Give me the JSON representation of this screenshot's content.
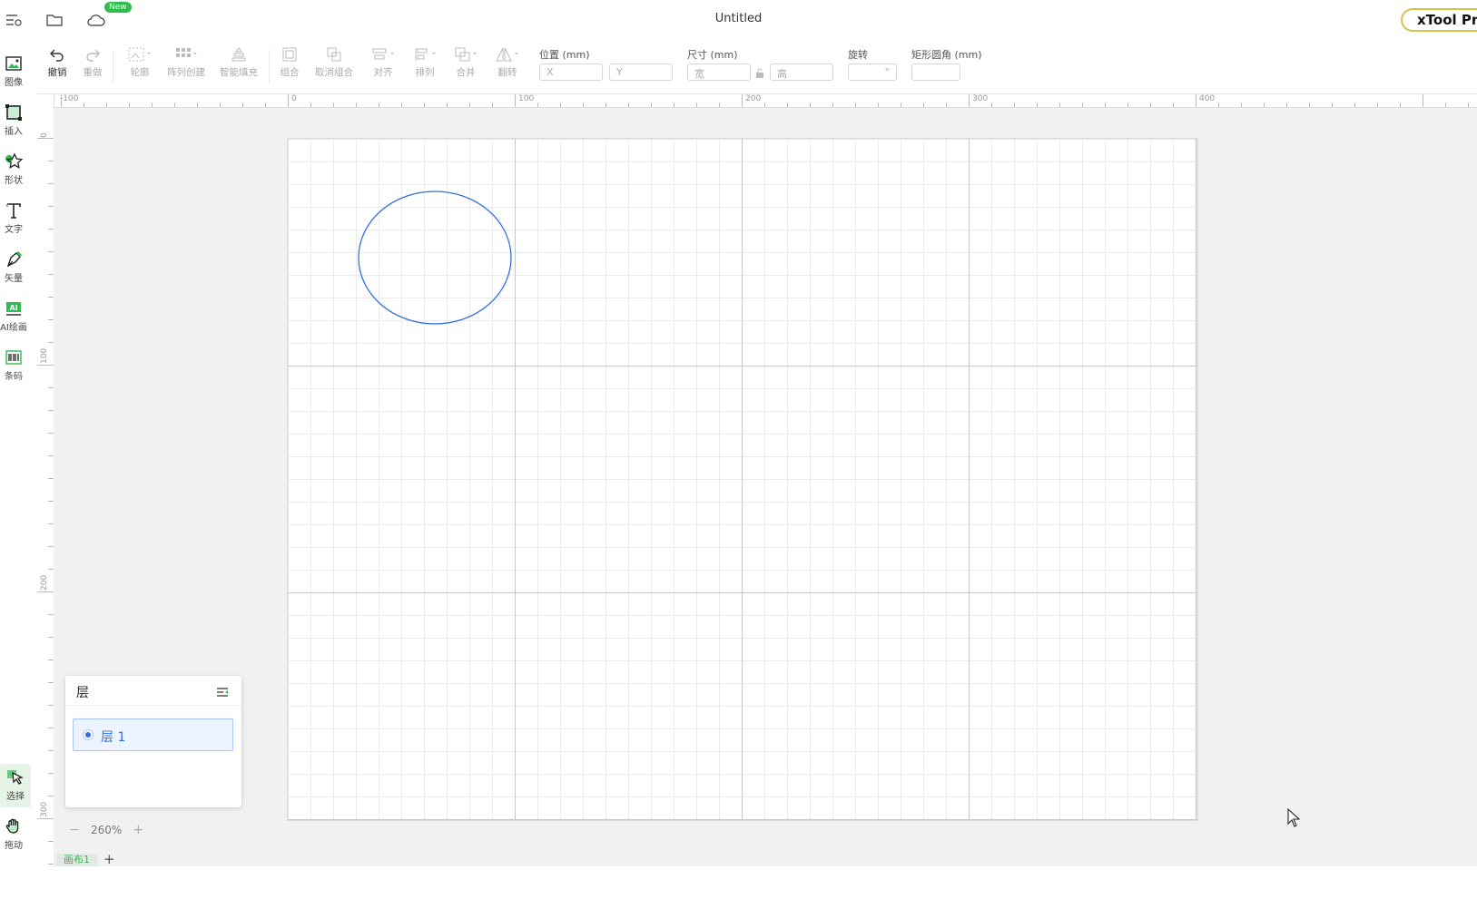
{
  "titlebar": {
    "new_badge": "New",
    "doc_title": "Untitled",
    "product_button": "xTool Pro"
  },
  "sidebar": {
    "items": [
      {
        "label": "图像",
        "icon": "image-icon"
      },
      {
        "label": "插入",
        "icon": "insert-icon"
      },
      {
        "label": "形状",
        "icon": "shape-star-icon"
      },
      {
        "label": "文字",
        "icon": "text-icon"
      },
      {
        "label": "矢量",
        "icon": "pen-icon"
      },
      {
        "label": "AI绘画",
        "icon": "ai-paint-icon"
      },
      {
        "label": "条码",
        "icon": "barcode-icon"
      }
    ],
    "bottom_items": [
      {
        "label": "选择",
        "icon": "select-cursor-icon"
      },
      {
        "label": "拖动",
        "icon": "hand-icon"
      }
    ],
    "accent": "#2ebd4e"
  },
  "toolbar": {
    "undo": "撤销",
    "redo": "重做",
    "outline": "轮廓",
    "array": "阵列创建",
    "smart_fill": "智能填充",
    "group": "组合",
    "ungroup": "取消组合",
    "align": "对齐",
    "arrange": "排列",
    "combine": "合并",
    "flip": "翻转",
    "position_label": "位置 (mm)",
    "x_placeholder": "X",
    "y_placeholder": "Y",
    "size_label": "尺寸 (mm)",
    "width_placeholder": "宽",
    "height_placeholder": "高",
    "rotate_label": "旋转",
    "rotate_unit": "°",
    "corner_label": "矩形圆角 (mm)"
  },
  "rulers": {
    "top": [
      "-100",
      "0",
      "100",
      "200",
      "300",
      "400"
    ],
    "left": [
      "0",
      "100",
      "200",
      "300"
    ]
  },
  "layers": {
    "title": "层",
    "items": [
      {
        "name": "层 1",
        "color": "#2f6fe0"
      }
    ]
  },
  "zoom": {
    "minus": "−",
    "value": "260%",
    "plus": "+"
  },
  "tabs": {
    "canvas_tab": "画布1",
    "add": "+"
  },
  "colors": {
    "ellipse_stroke": "#2f6fe0",
    "grid_major": "#c8c8c8",
    "grid_minor": "#ececec"
  }
}
